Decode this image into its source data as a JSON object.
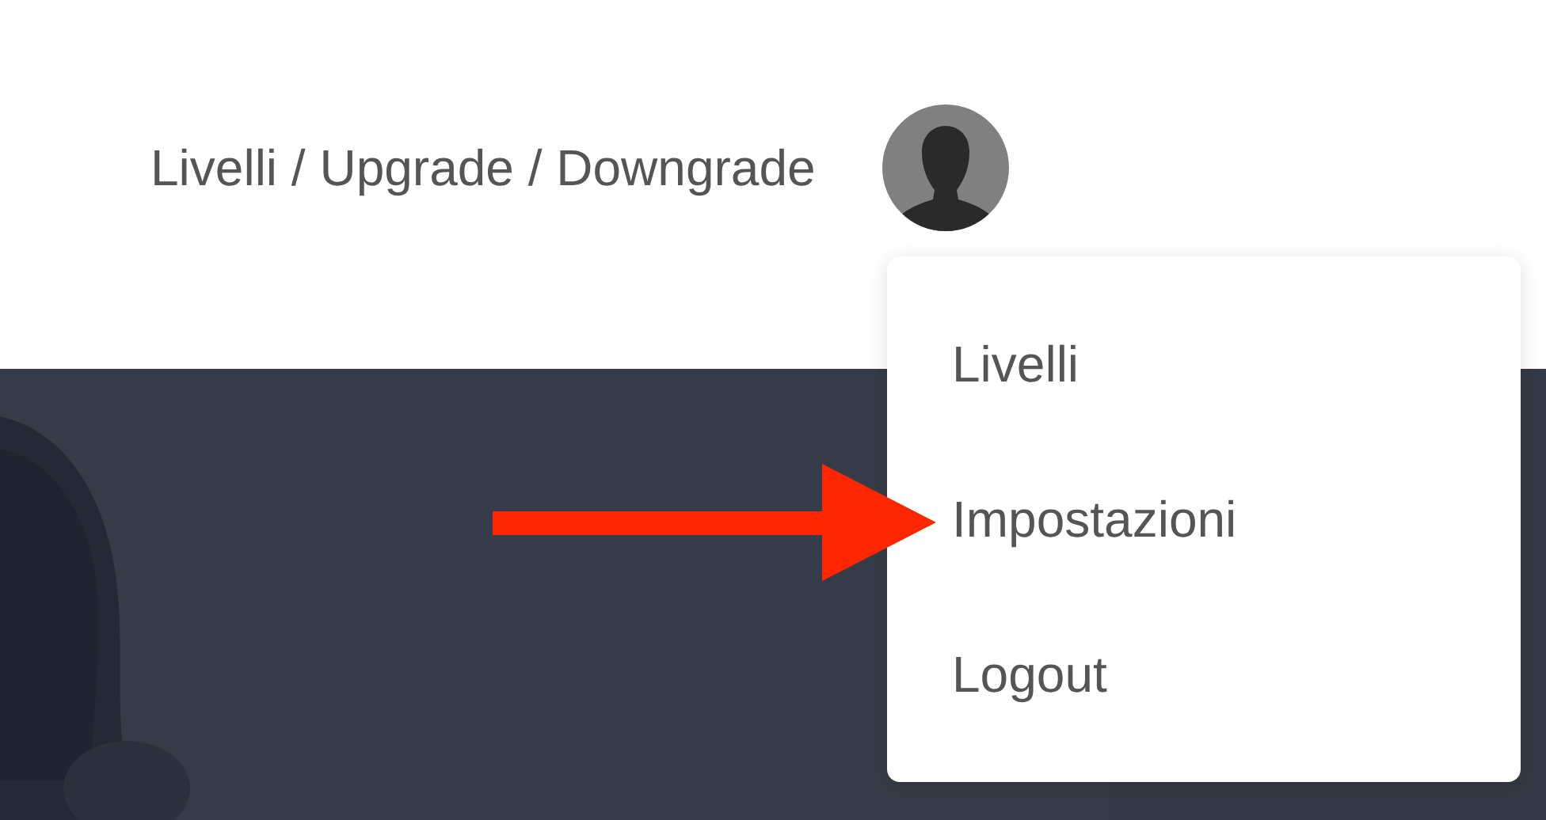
{
  "header": {
    "breadcrumb": "Livelli / Upgrade / Downgrade"
  },
  "user_menu": {
    "open": true,
    "items": [
      {
        "label": "Livelli"
      },
      {
        "label": "Impostazioni"
      },
      {
        "label": "Logout"
      }
    ]
  }
}
